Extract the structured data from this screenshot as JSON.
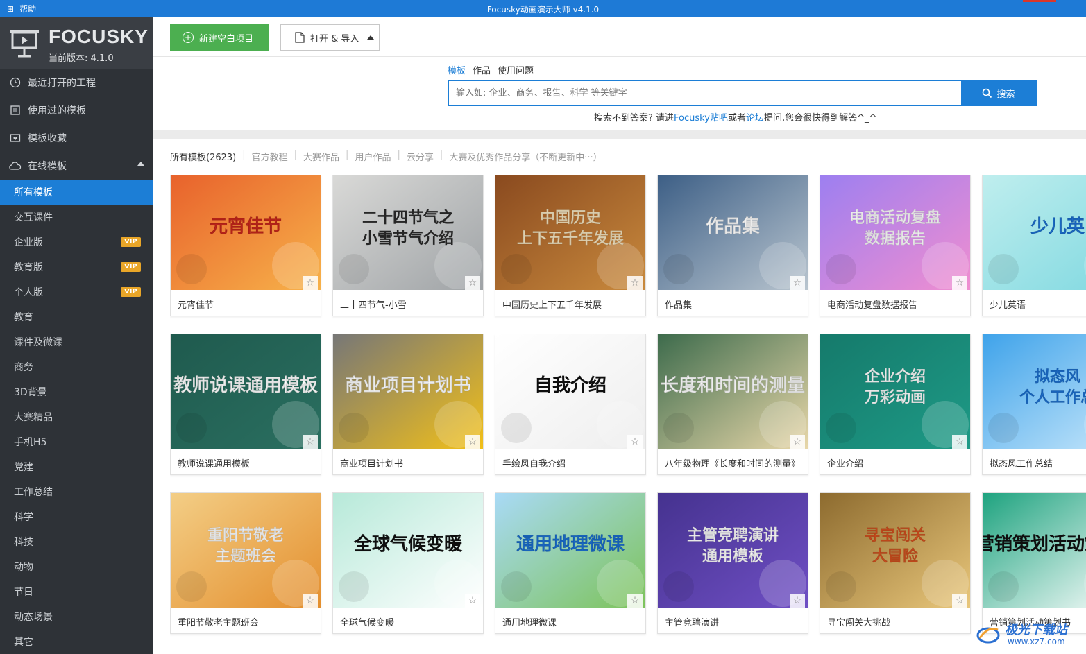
{
  "titlebar": {
    "help": "帮助",
    "title": "Focusky动画演示大师 v4.1.0"
  },
  "brand": {
    "logo": "FOCUSKY",
    "version": "当前版本: 4.1.0"
  },
  "sidebar": {
    "top_items": [
      {
        "label": "最近打开的工程",
        "icon": "clock-icon"
      },
      {
        "label": "使用过的模板",
        "icon": "template-icon"
      },
      {
        "label": "模板收藏",
        "icon": "heart-folder-icon"
      },
      {
        "label": "在线模板",
        "icon": "cloud-icon"
      }
    ],
    "vip": "VIP",
    "categories": [
      {
        "label": "所有模板",
        "active": true,
        "vip": false
      },
      {
        "label": "交互课件",
        "vip": false
      },
      {
        "label": "企业版",
        "vip": true
      },
      {
        "label": "教育版",
        "vip": true
      },
      {
        "label": "个人版",
        "vip": true
      },
      {
        "label": "教育",
        "vip": false
      },
      {
        "label": "课件及微课",
        "vip": false
      },
      {
        "label": "商务",
        "vip": false
      },
      {
        "label": "3D背景",
        "vip": false
      },
      {
        "label": "大赛精品",
        "vip": false
      },
      {
        "label": "手机H5",
        "vip": false
      },
      {
        "label": "党建",
        "vip": false
      },
      {
        "label": "工作总结",
        "vip": false
      },
      {
        "label": "科学",
        "vip": false
      },
      {
        "label": "科技",
        "vip": false
      },
      {
        "label": "动物",
        "vip": false
      },
      {
        "label": "节日",
        "vip": false
      },
      {
        "label": "动态场景",
        "vip": false
      },
      {
        "label": "其它",
        "vip": false
      }
    ]
  },
  "toolbar": {
    "new_label": "新建空白项目",
    "open_label": "打开 & 导入"
  },
  "search": {
    "tabs": [
      "模板",
      "作品",
      "使用问题"
    ],
    "placeholder": "输入如: 企业、商务、报告、科学 等关键字",
    "button": "搜索",
    "hint_prefix": "搜索不到答案? 请进",
    "hint_link1": "Focusky贴吧",
    "hint_mid": "或者",
    "hint_link2": "论坛",
    "hint_suffix": "提问,您会很快得到解答^_^"
  },
  "filters": [
    "所有模板(2623)",
    "官方教程",
    "大赛作品",
    "用户作品",
    "云分享",
    "大赛及优秀作品分享（不断更新中···）"
  ],
  "cards": [
    {
      "label": "元宵佳节",
      "thumb_title": "元宵佳节",
      "bg": "#e8622c",
      "bg2": "#f7b24a",
      "fg": "#c8261b"
    },
    {
      "label": "二十四节气-小雪",
      "thumb_title": "二十四节气之 小雪节气介绍",
      "bg": "#d9d9d7",
      "bg2": "#9fa3a6",
      "fg": "#2b2b2b"
    },
    {
      "label": "中国历史上下五千年发展",
      "thumb_title": "中国历史 上下五千年发展",
      "bg": "#8a4a1f",
      "bg2": "#c98a3d",
      "fg": "#f3e3c0"
    },
    {
      "label": "作品集",
      "thumb_title": "作品集",
      "bg": "#3d5f86",
      "bg2": "#b9c5cf",
      "fg": "#ffffff"
    },
    {
      "label": "电商活动复盘数据报告",
      "thumb_title": "电商活动复盘 数据报告",
      "bg": "#9d7ff0",
      "bg2": "#f08ed0",
      "fg": "#ffffff"
    },
    {
      "label": "少儿英语",
      "thumb_title": "少儿英",
      "bg": "#bfeeee",
      "bg2": "#7fd8e0",
      "fg": "#1b6fd0"
    },
    {
      "label": "教师说课通用模板",
      "thumb_title": "教师说课通用模板",
      "bg": "#1f5a4e",
      "bg2": "#2a6f60",
      "fg": "#ffffff"
    },
    {
      "label": "商业项目计划书",
      "thumb_title": "商业项目计划书",
      "bg": "#777777",
      "bg2": "#f2c019",
      "fg": "#ffffff"
    },
    {
      "label": "手绘风自我介绍",
      "thumb_title": "自我介绍",
      "bg": "#ffffff",
      "bg2": "#eeeeee",
      "fg": "#111111"
    },
    {
      "label": "八年级物理《长度和时间的测量》",
      "thumb_title": "长度和时间的测量",
      "bg": "#3d6b4c",
      "bg2": "#e8d7a9",
      "fg": "#ffffff"
    },
    {
      "label": "企业介绍",
      "thumb_title": "企业介绍 万彩动画",
      "bg": "#157a6b",
      "bg2": "#1e9a86",
      "fg": "#ffffff"
    },
    {
      "label": "拟态风工作总结",
      "thumb_title": "拟态风 个人工作总",
      "bg": "#3fa3ea",
      "bg2": "#c9e8fb",
      "fg": "#1b6fd0"
    },
    {
      "label": "重阳节敬老主题班会",
      "thumb_title": "重阳节敬老 主题班会",
      "bg": "#f3ce86",
      "bg2": "#e48f2e",
      "fg": "#ffffff"
    },
    {
      "label": "全球气候变暖",
      "thumb_title": "全球气候变暖",
      "bg": "#b7e9d9",
      "bg2": "#ffffff",
      "fg": "#111111"
    },
    {
      "label": "通用地理微课",
      "thumb_title": "通用地理微课",
      "bg": "#a9daf6",
      "bg2": "#7dc35a",
      "fg": "#1b6fd0"
    },
    {
      "label": "主管竞聘演讲",
      "thumb_title": "主管竞聘演讲 通用模板",
      "bg": "#45328f",
      "bg2": "#6f4fc4",
      "fg": "#ffffff"
    },
    {
      "label": "寻宝闯关大挑战",
      "thumb_title": "寻宝闯关 大冒险",
      "bg": "#8d6b2f",
      "bg2": "#e9c77b",
      "fg": "#d4501e"
    },
    {
      "label": "营销策划活动策划书",
      "thumb_title": "营销策划活动策划书",
      "bg": "#1ea37f",
      "bg2": "#ffffff",
      "fg": "#111111"
    }
  ],
  "watermark": {
    "line1": "极光下载站",
    "line2": "www.xz7.com"
  }
}
